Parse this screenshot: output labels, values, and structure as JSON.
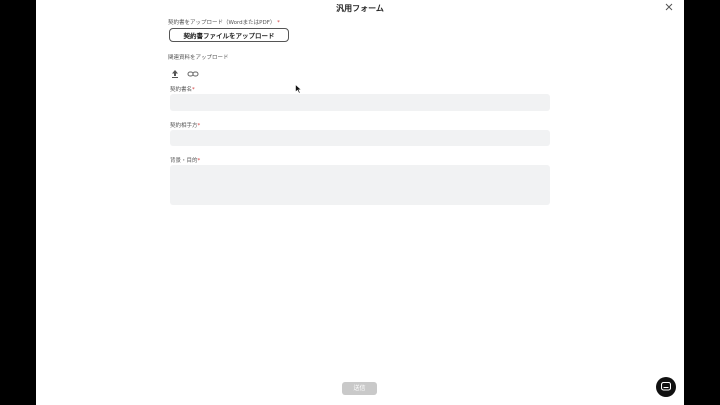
{
  "header": {
    "title": "汎用フォーム",
    "close_icon": "close-icon"
  },
  "upload": {
    "label": "契約書をアップロード（WordまたはPDF）",
    "required_mark": "*",
    "button_label": "契約書ファイルをアップロード"
  },
  "related": {
    "label": "関連資料をアップロード",
    "upload_icon": "upload-icon",
    "link_icon": "link-icon"
  },
  "fields": {
    "contract_name": {
      "label": "契約書名",
      "required_mark": "*",
      "value": ""
    },
    "counterparty": {
      "label": "契約相手方",
      "required_mark": "*",
      "value": ""
    },
    "background": {
      "label": "背景・目的",
      "required_mark": "*",
      "value": ""
    }
  },
  "footer": {
    "submit_label": "送信",
    "chat_icon": "chat-icon"
  },
  "colors": {
    "field_bg": "#f1f2f3",
    "required": "#d23b3b",
    "submit_disabled": "#c9c9c9"
  }
}
